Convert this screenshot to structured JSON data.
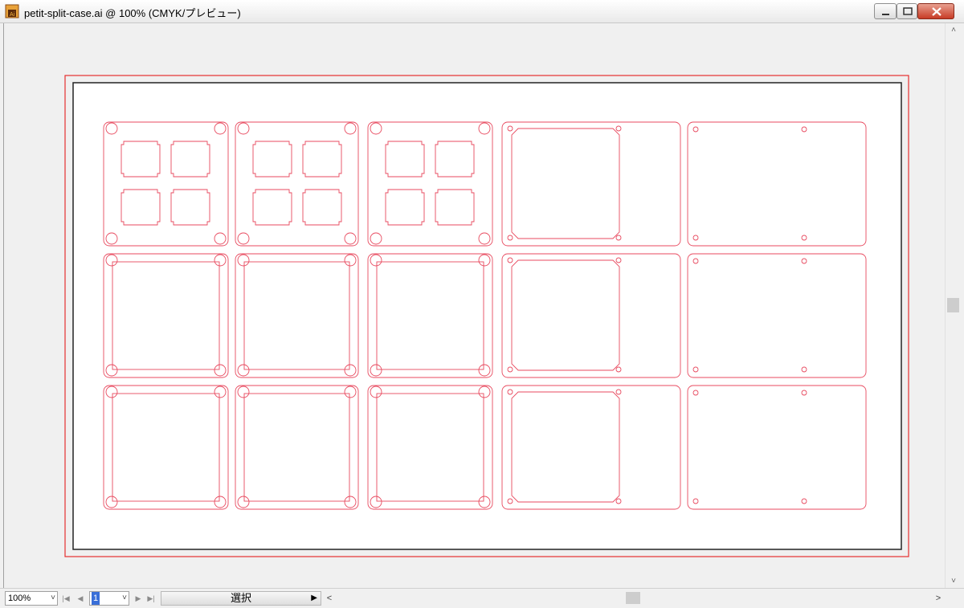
{
  "window": {
    "title": "petit-split-case.ai @ 100% (CMYK/プレビュー)",
    "app_icon": "illustrator-document-icon",
    "controls": [
      "minimize-icon",
      "maximize-icon",
      "close-icon"
    ]
  },
  "status": {
    "zoom": "100%",
    "page": "1",
    "tool": "選択"
  },
  "artboard": {
    "stroke_color": "#e84a5f",
    "border_color": "#222222",
    "bleed_color": "#e62e2e",
    "rows": 3,
    "columns": 5
  }
}
